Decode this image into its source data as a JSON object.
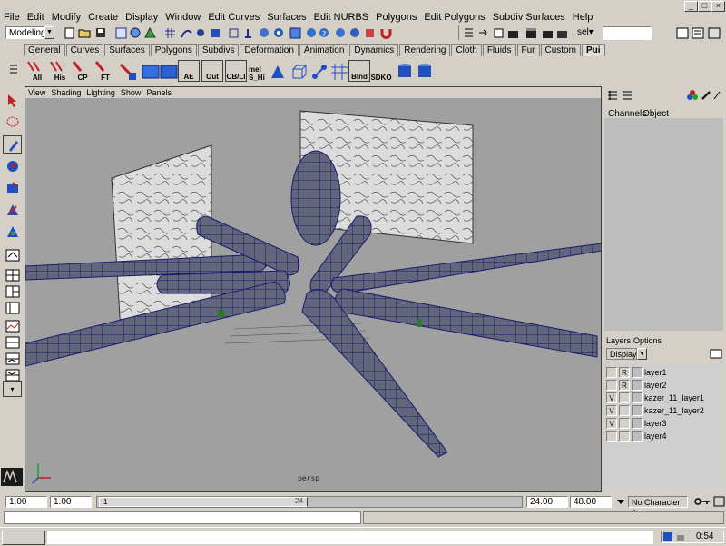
{
  "menus": [
    "File",
    "Edit",
    "Modify",
    "Create",
    "Display",
    "Window",
    "Edit Curves",
    "Surfaces",
    "Edit NURBS",
    "Polygons",
    "Edit Polygons",
    "Subdiv Surfaces",
    "Help"
  ],
  "window_buttons": [
    "_",
    "□",
    "×"
  ],
  "status_line": {
    "mode": "Modeling",
    "sel_label": "sel▾",
    "quick_select_value": ""
  },
  "shelf_tabs": [
    "General",
    "Curves",
    "Surfaces",
    "Polygons",
    "Subdivs",
    "Deformation",
    "Animation",
    "Dynamics",
    "Rendering",
    "Cloth",
    "Fluids",
    "Fur",
    "Custom",
    "Pui"
  ],
  "active_shelf_tab": "Pui",
  "shelf_buttons": [
    "All",
    "His",
    "CP",
    "FT",
    "",
    "",
    "",
    "AE",
    "Out",
    "CB/LI",
    "mel S_Hi",
    "",
    "",
    "",
    "",
    "Blnd",
    "SDKO",
    "",
    ""
  ],
  "view_menus": [
    "View",
    "Shading",
    "Lighting",
    "Show",
    "Panels"
  ],
  "viewport": {
    "camera_label": "persp"
  },
  "channel_box": {
    "tabs": [
      "Channels",
      "Object"
    ]
  },
  "layers": {
    "tabs": [
      "Layers",
      "Options"
    ],
    "display_dropdown": "Display",
    "rows": [
      {
        "v": "",
        "r": "R",
        "name": "layer1"
      },
      {
        "v": "",
        "r": "R",
        "name": "layer2"
      },
      {
        "v": "V",
        "r": "",
        "name": "kazer_11_layer1"
      },
      {
        "v": "V",
        "r": "",
        "name": "kazer_11_layer2"
      },
      {
        "v": "V",
        "r": "",
        "name": "layer3"
      },
      {
        "v": "",
        "r": "",
        "name": "layer4"
      }
    ]
  },
  "time": {
    "start": "1.00",
    "playback_start": "1.00",
    "current_frame_marker": "1",
    "end_tick": "24",
    "playback_end": "24.00",
    "end": "48.00",
    "character_set": "No Character Set"
  },
  "taskbar": {
    "clock": "0:54"
  },
  "colors": {
    "wire": "#1a1a6e",
    "viewport_bg": "#a0a0a0",
    "ui_grey": "#d4d0c8"
  }
}
